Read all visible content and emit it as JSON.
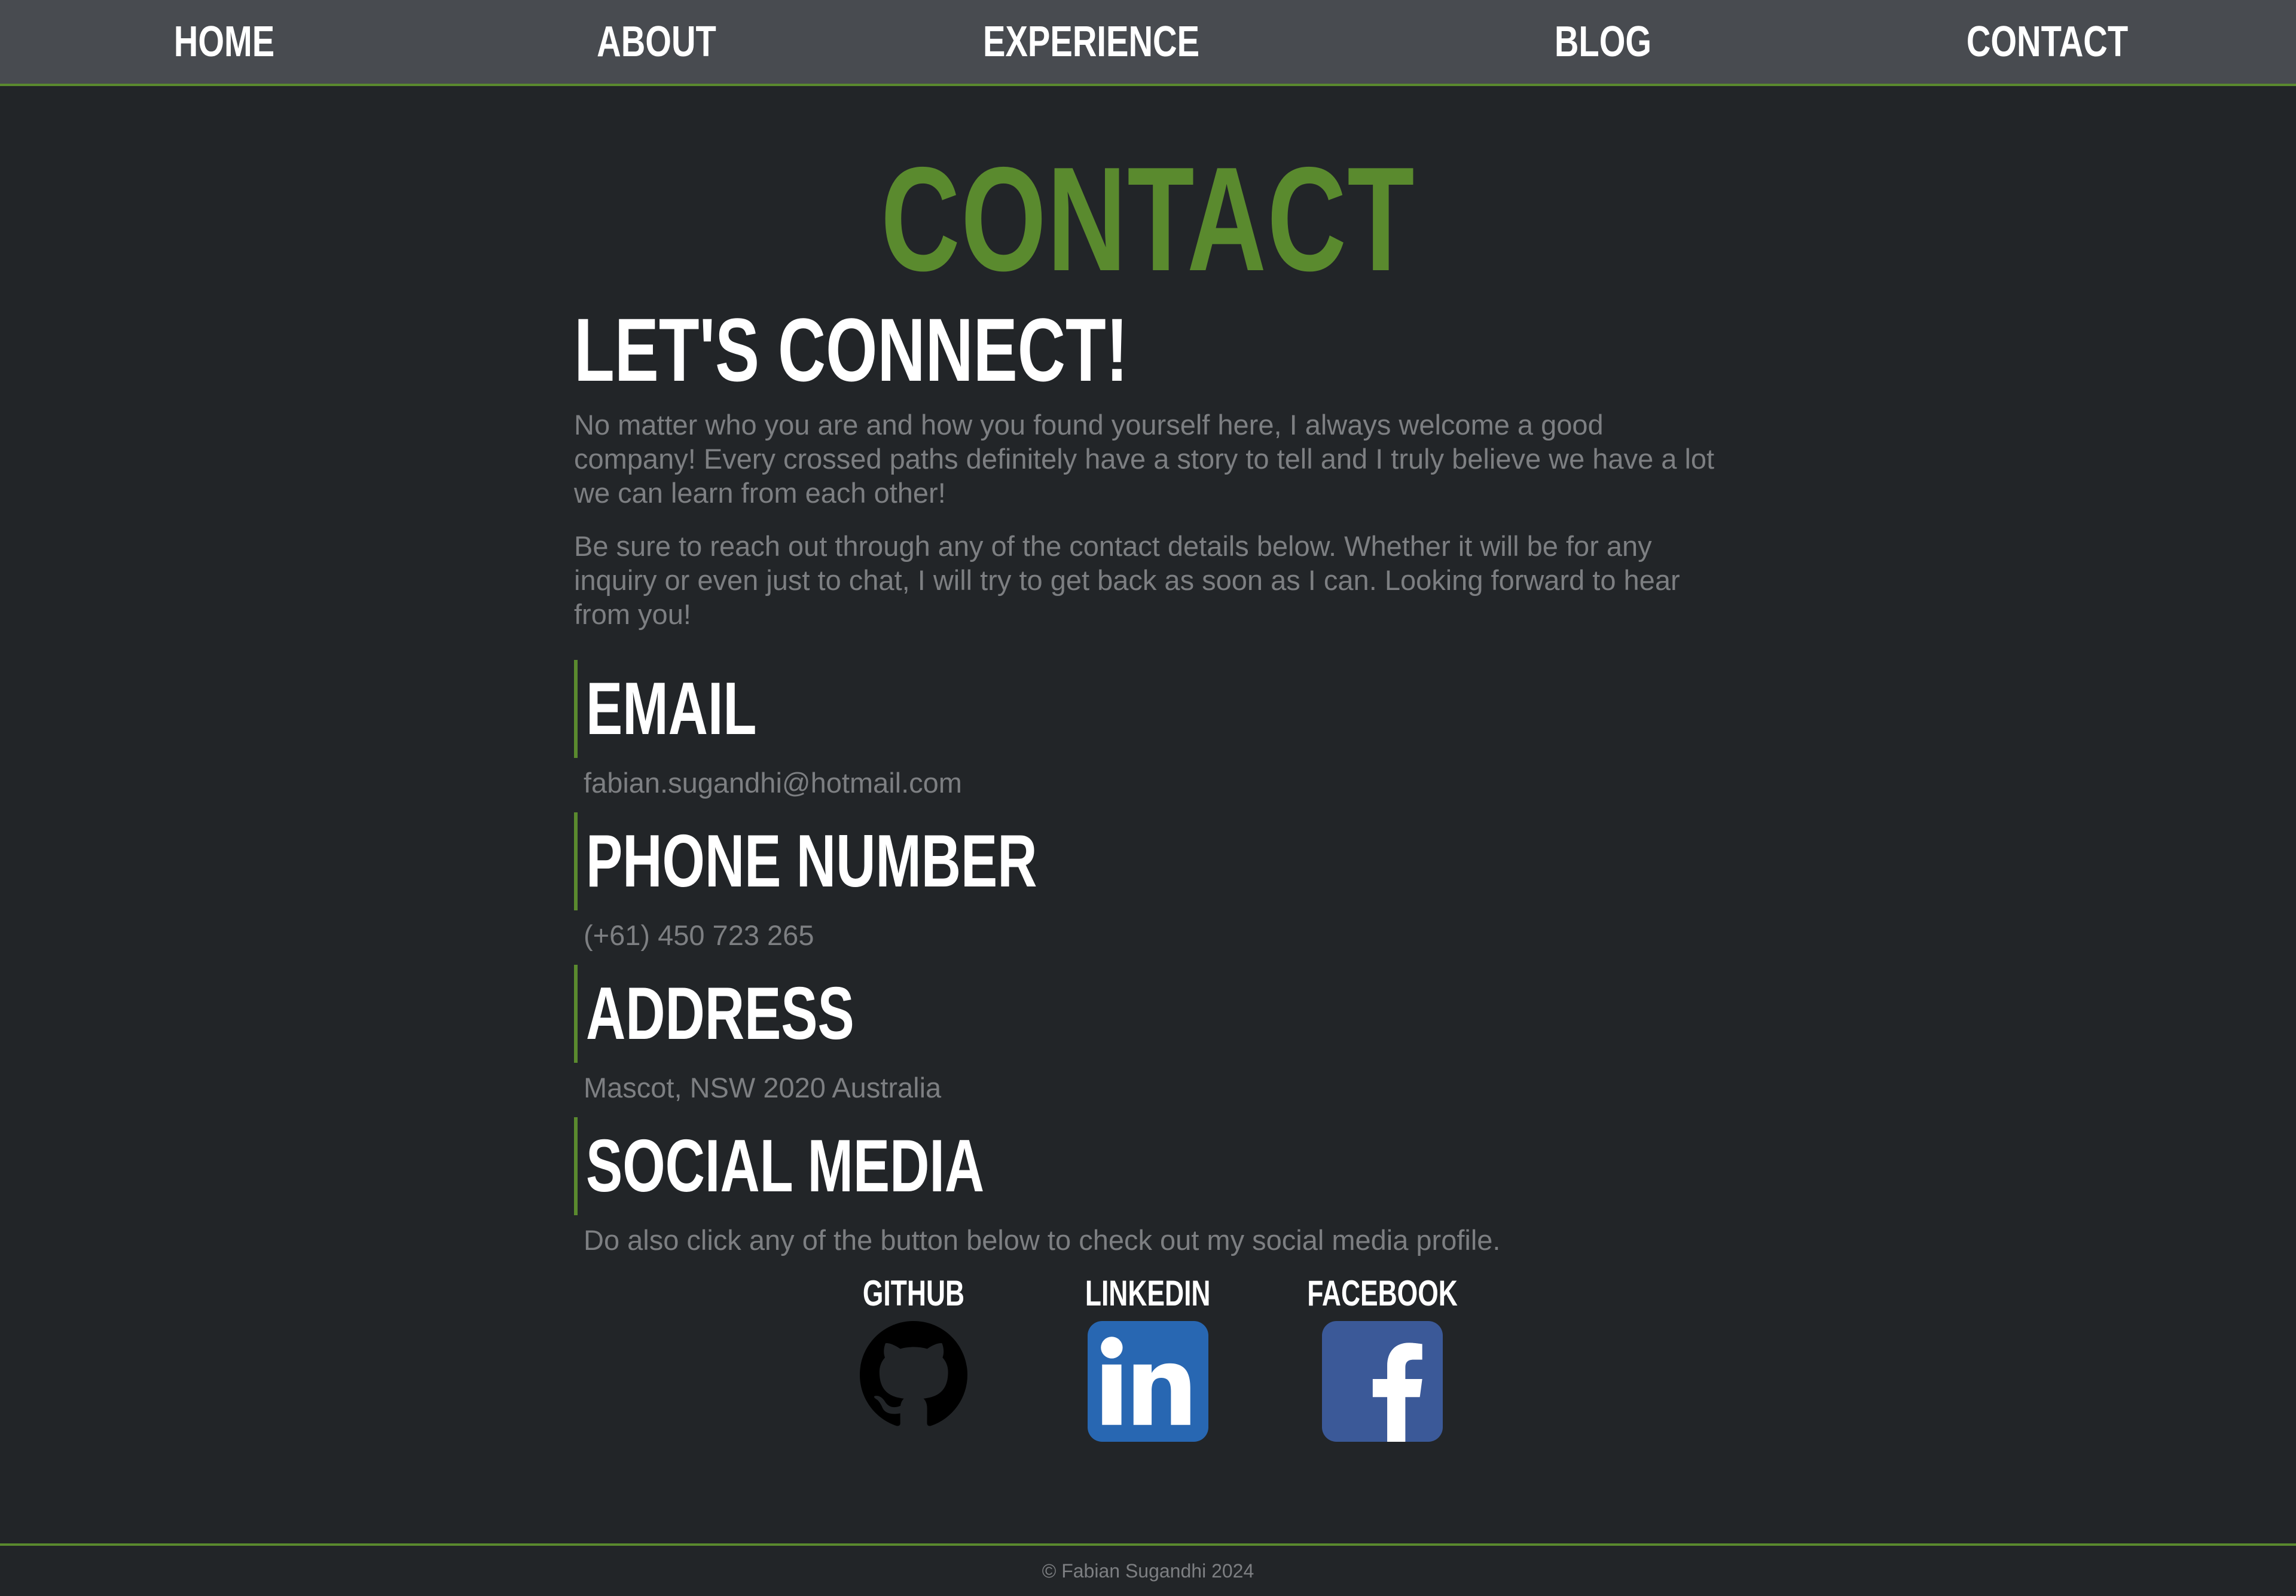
{
  "nav": {
    "items": [
      {
        "label": "HOME"
      },
      {
        "label": "ABOUT"
      },
      {
        "label": "EXPERIENCE"
      },
      {
        "label": "BLOG"
      },
      {
        "label": "CONTACT"
      }
    ]
  },
  "page": {
    "title": "CONTACT",
    "heading": "LET'S CONNECT!",
    "intro": [
      "No matter who you are and how you found yourself here, I always welcome a good company! Every crossed paths definitely have a story to tell and I truly believe we have a lot we can learn from each other!",
      "Be sure to reach out through any of the contact details below. Whether it will be for any inquiry or even just to chat, I will try to get back as soon as I can. Looking forward to hear from you!"
    ]
  },
  "sections": {
    "email": {
      "title": "EMAIL",
      "value": "fabian.sugandhi@hotmail.com"
    },
    "phone": {
      "title": "PHONE NUMBER",
      "value": "(+61) 450 723 265"
    },
    "address": {
      "title": "ADDRESS",
      "value": "Mascot, NSW 2020 Australia"
    },
    "social": {
      "title": "SOCIAL MEDIA",
      "value": "Do also click any of the button below to check out my social media profile."
    }
  },
  "social_links": [
    {
      "label": "GITHUB",
      "icon": "github-icon"
    },
    {
      "label": "LINKEDIN",
      "icon": "linkedin-icon",
      "color": "#2867b2"
    },
    {
      "label": "FACEBOOK",
      "icon": "facebook-icon",
      "color": "#3b5998"
    }
  ],
  "footer": {
    "text": "© Fabian Sugandhi 2024"
  },
  "colors": {
    "accent": "#5a8a2e",
    "background": "#222528",
    "nav_background": "#484b50",
    "text_muted": "#7d7f82"
  }
}
